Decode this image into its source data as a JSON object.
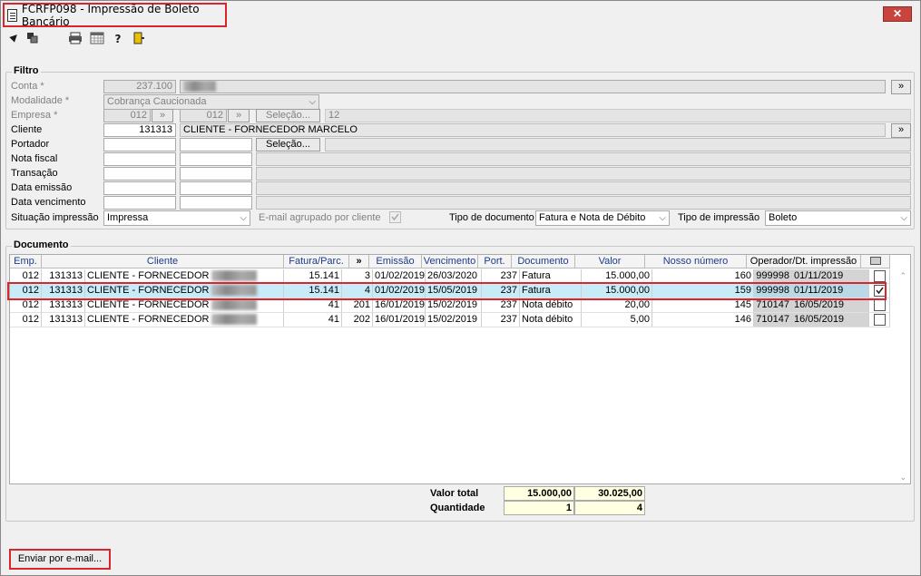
{
  "window": {
    "title": "FCRFP098 - Impressão de Boleto Bancário",
    "close_label": "✕"
  },
  "filtro": {
    "label": "Filtro",
    "conta": {
      "label": "Conta *",
      "value": "237.100"
    },
    "modalidade": {
      "label": "Modalidade *",
      "value": "Cobrança Caucionada"
    },
    "empresa": {
      "label": "Empresa *",
      "value1": "012",
      "value2": "012",
      "selecao": "Seleção...",
      "count": "12"
    },
    "cliente": {
      "label": "Cliente",
      "code": "131313",
      "name": "CLIENTE - FORNECEDOR MARCELO"
    },
    "portador": {
      "label": "Portador",
      "selecao": "Seleção..."
    },
    "nota_fiscal": {
      "label": "Nota fiscal"
    },
    "transacao": {
      "label": "Transação"
    },
    "data_emissao": {
      "label": "Data emissão"
    },
    "data_vencimento": {
      "label": "Data vencimento"
    },
    "situacao": {
      "label": "Situação impressão",
      "value": "Impressa"
    },
    "email_agrupado": {
      "label": "E-mail agrupado por cliente",
      "checked": true
    },
    "tipo_documento": {
      "label": "Tipo de documento",
      "value": "Fatura e Nota de Débito"
    },
    "tipo_impressao": {
      "label": "Tipo de impressão",
      "value": "Boleto"
    },
    "more_button": "»"
  },
  "documento": {
    "label": "Documento",
    "headers": {
      "emp": "Emp.",
      "cliente": "Cliente",
      "fatura": "Fatura/Parc.",
      "expand": "»",
      "emissao": "Emissão",
      "vencimento": "Vencimento",
      "port": "Port.",
      "documento": "Documento",
      "valor": "Valor",
      "nosso": "Nosso número",
      "operador": "Operador/Dt. impressão"
    },
    "rows": [
      {
        "emp": "012",
        "code": "131313",
        "cliente": "CLIENTE - FORNECEDOR",
        "fatura": "15.141",
        "parc": "3",
        "emissao": "01/02/2019",
        "vencimento": "26/03/2020",
        "port": "237",
        "documento": "Fatura",
        "valor": "15.000,00",
        "nosso": "160",
        "operador": "999998",
        "dt": "01/11/2019",
        "checked": false
      },
      {
        "emp": "012",
        "code": "131313",
        "cliente": "CLIENTE - FORNECEDOR",
        "fatura": "15.141",
        "parc": "4",
        "emissao": "01/02/2019",
        "vencimento": "15/05/2019",
        "port": "237",
        "documento": "Fatura",
        "valor": "15.000,00",
        "nosso": "159",
        "operador": "999998",
        "dt": "01/11/2019",
        "checked": true
      },
      {
        "emp": "012",
        "code": "131313",
        "cliente": "CLIENTE - FORNECEDOR",
        "fatura": "41",
        "parc": "201",
        "emissao": "16/01/2019",
        "vencimento": "15/02/2019",
        "port": "237",
        "documento": "Nota débito",
        "valor": "20,00",
        "nosso": "145",
        "operador": "710147",
        "dt": "16/05/2019",
        "checked": false
      },
      {
        "emp": "012",
        "code": "131313",
        "cliente": "CLIENTE - FORNECEDOR",
        "fatura": "41",
        "parc": "202",
        "emissao": "16/01/2019",
        "vencimento": "15/02/2019",
        "port": "237",
        "documento": "Nota débito",
        "valor": "5,00",
        "nosso": "146",
        "operador": "710147",
        "dt": "16/05/2019",
        "checked": false
      }
    ],
    "totals": {
      "valor_label": "Valor total",
      "valor_sel": "15.000,00",
      "valor_all": "30.025,00",
      "qtd_label": "Quantidade",
      "qtd_sel": "1",
      "qtd_all": "4"
    }
  },
  "footer": {
    "email_button": "Enviar por e-mail..."
  },
  "colors": {
    "highlight": "#d9262c",
    "selected_row": "#c7ebf8",
    "total_bg": "#ffffe1",
    "header_text": "#1a3c8c"
  }
}
